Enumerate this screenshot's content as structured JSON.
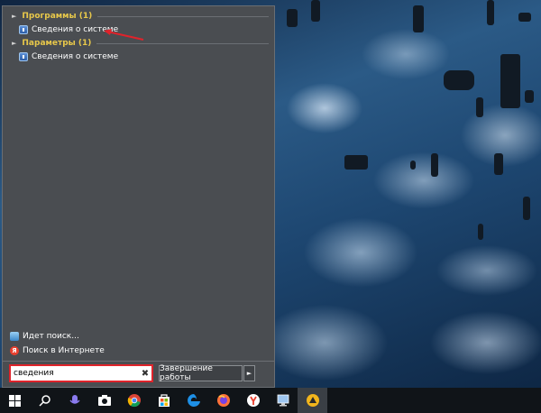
{
  "start_menu": {
    "programs_header": "Программы (1)",
    "programs_item": "Сведения о системе",
    "settings_header": "Параметры (1)",
    "settings_item": "Сведения о системе",
    "searching_label": "Идет поиск...",
    "web_search_label": "Поиск в Интернете",
    "search_value": "сведения",
    "shutdown_label": "Завершение работы"
  },
  "taskbar": {
    "icons": [
      "windows-start-icon",
      "search-icon",
      "cortana-icon",
      "camera-icon",
      "chrome-icon",
      "store-icon",
      "edge-icon",
      "firefox-icon",
      "yandex-browser-icon",
      "system-info-icon",
      "app-icon"
    ]
  },
  "colors": {
    "menu_bg": "#4a4d51",
    "section_header": "#e8c84a",
    "highlight_border": "#e0232b",
    "taskbar_bg": "#101418"
  }
}
